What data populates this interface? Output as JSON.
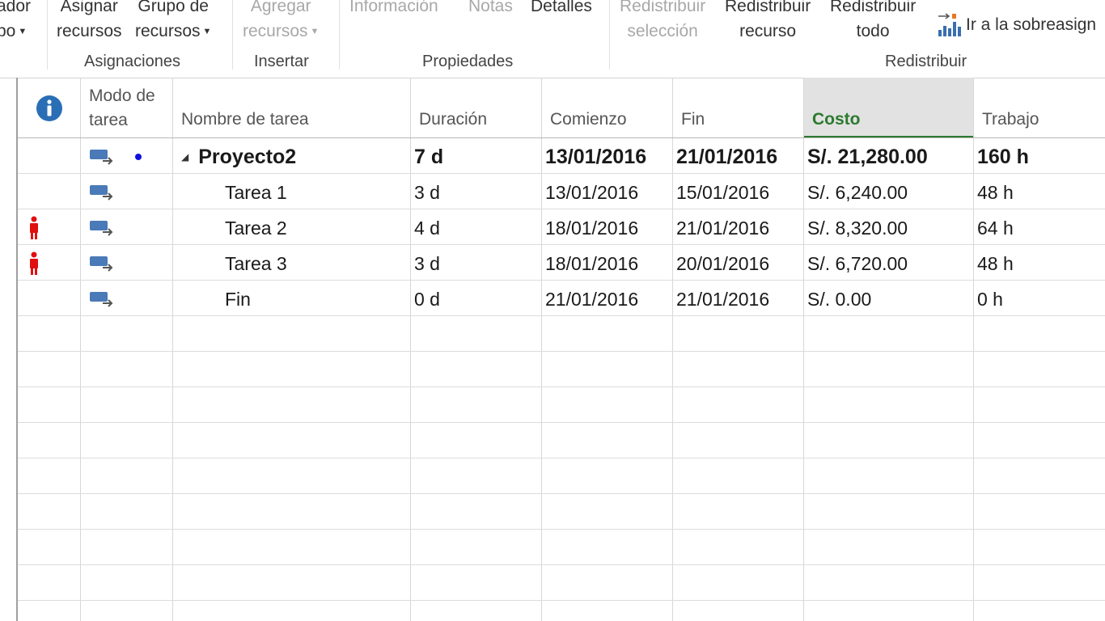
{
  "ribbon": {
    "partial_btn": {
      "line1": "ador",
      "line2": "po"
    },
    "asignar": {
      "line1": "Asignar",
      "line2": "recursos"
    },
    "grupo": {
      "line1": "Grupo de",
      "line2": "recursos"
    },
    "agregar": {
      "line1": "Agregar",
      "line2": "recursos"
    },
    "informacion": "Información",
    "notas": "Notas",
    "detalles": "Detalles",
    "redist_sel": {
      "line1": "Redistribuir",
      "line2": "selección"
    },
    "redist_rec": {
      "line1": "Redistribuir",
      "line2": "recurso"
    },
    "redist_todo": {
      "line1": "Redistribuir",
      "line2": "todo"
    },
    "ir_sobreasig": "Ir a la sobreasign",
    "groups": {
      "asignaciones": "Asignaciones",
      "insertar": "Insertar",
      "propiedades": "Propiedades",
      "redistribuir": "Redistribuir"
    }
  },
  "table": {
    "headers": {
      "modo_line1": "Modo de",
      "modo_line2": "tarea",
      "nombre": "Nombre de tarea",
      "duracion": "Duración",
      "comienzo": "Comienzo",
      "fin": "Fin",
      "costo": "Costo",
      "trabajo": "Trabajo"
    },
    "rows": [
      {
        "name": "Proyecto2",
        "duration": "7 d",
        "start": "13/01/2016",
        "end": "21/01/2016",
        "cost": "S/. 21,280.00",
        "work": "160 h"
      },
      {
        "name": "Tarea 1",
        "duration": "3 d",
        "start": "13/01/2016",
        "end": "15/01/2016",
        "cost": "S/. 6,240.00",
        "work": "48 h"
      },
      {
        "name": "Tarea 2",
        "duration": "4 d",
        "start": "18/01/2016",
        "end": "21/01/2016",
        "cost": "S/. 8,320.00",
        "work": "64 h"
      },
      {
        "name": "Tarea 3",
        "duration": "3 d",
        "start": "18/01/2016",
        "end": "20/01/2016",
        "cost": "S/. 6,720.00",
        "work": "48 h"
      },
      {
        "name": "Fin",
        "duration": "0 d",
        "start": "21/01/2016",
        "end": "21/01/2016",
        "cost": "S/. 0.00",
        "work": "0 h"
      }
    ]
  },
  "colors": {
    "sorted_header_text": "#2c7a2f",
    "overallocated_icon": "#e01010",
    "task_mode_icon": "#4a7ab8",
    "info_icon": "#2a6fb5",
    "summary_dot": "#1010e0"
  }
}
